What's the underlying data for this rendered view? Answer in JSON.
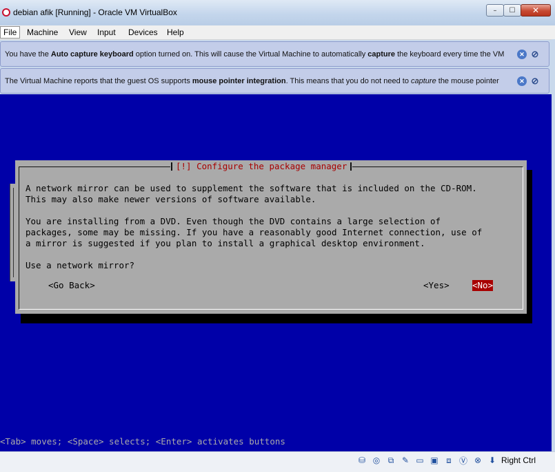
{
  "window": {
    "title": "debian afik [Running] - Oracle VM VirtualBox",
    "controls": {
      "minimize": "–",
      "maximize": "☐",
      "close": "✕"
    }
  },
  "menu": {
    "items": [
      "File",
      "Machine",
      "View",
      "Input",
      "Devices",
      "Help"
    ],
    "active_index": 0
  },
  "notices": [
    {
      "parts": [
        {
          "text": "You have the ",
          "bold": false
        },
        {
          "text": "Auto capture keyboard",
          "bold": true
        },
        {
          "text": " option turned on. This will cause the Virtual Machine to automatically ",
          "bold": false
        },
        {
          "text": "capture",
          "bold": true
        },
        {
          "text": " the keyboard every time the VM",
          "bold": false
        }
      ]
    },
    {
      "parts": [
        {
          "text": "The Virtual Machine reports that the guest OS supports ",
          "bold": false
        },
        {
          "text": "mouse pointer integration",
          "bold": true
        },
        {
          "text": ". This means that you do not need to ",
          "bold": false
        },
        {
          "text": "capture",
          "italic": true
        },
        {
          "text": " the mouse pointer",
          "bold": false
        }
      ]
    }
  ],
  "dialog": {
    "title": "[!] Configure the package manager",
    "lines": [
      "A network mirror can be used to supplement the software that is included on the CD-ROM.",
      "This may also make newer versions of software available.",
      "",
      "You are installing from a DVD. Even though the DVD contains a large selection of",
      "packages, some may be missing. If you have a reasonably good Internet connection, use of",
      "a mirror is suggested if you plan to install a graphical desktop environment.",
      "",
      "Use a network mirror?"
    ],
    "buttons": {
      "go_back": "<Go Back>",
      "yes": "<Yes>",
      "no": "<No>"
    }
  },
  "help_line": "<Tab> moves; <Space> selects; <Enter> activates buttons",
  "statusbar": {
    "icons": [
      "hard-disk-icon",
      "optical-drive-icon",
      "network-icon",
      "usb-icon",
      "shared-folder-icon",
      "display-icon",
      "recording-icon",
      "virtualization-icon",
      "mouse-integration-icon",
      "host-key-arrow-icon"
    ],
    "host_key": "Right Ctrl"
  }
}
